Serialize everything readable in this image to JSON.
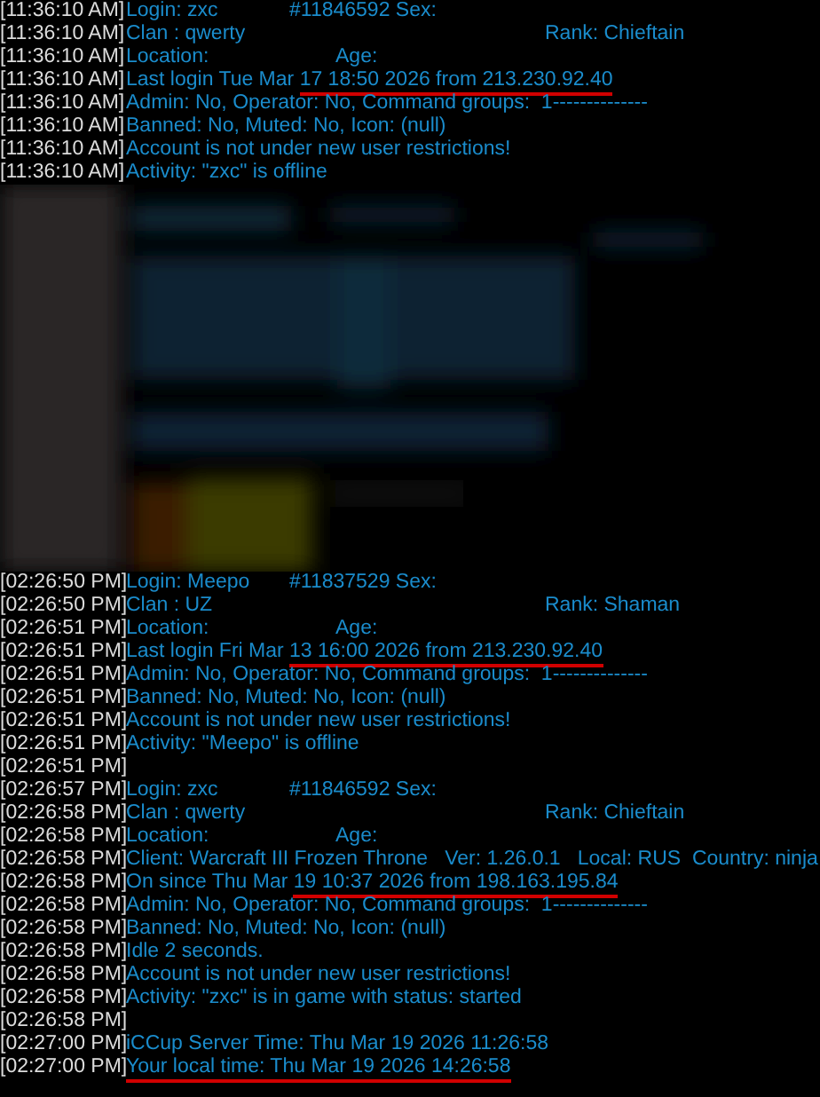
{
  "log_top": [
    {
      "time": "[11:36:10 AM]",
      "kind": "login",
      "text": "Login: zxc",
      "text_2": "#11846592 Sex:"
    },
    {
      "time": "[11:36:10 AM]",
      "kind": "clan",
      "text": "Clan : qwerty",
      "text_2": "Rank: Chieftain"
    },
    {
      "time": "[11:36:10 AM]",
      "kind": "location",
      "text": "Location:",
      "text_2": "Age:"
    },
    {
      "time": "[11:36:10 AM]",
      "kind": "plain",
      "text": "Last login Tue Mar ",
      "marked": "17 18:50 2026 from 213.230.92.40"
    },
    {
      "time": "[11:36:10 AM]",
      "kind": "plain",
      "text": "Admin: No, Operator: No, Command groups:  1--------------"
    },
    {
      "time": "[11:36:10 AM]",
      "kind": "plain",
      "text": "Banned: No, Muted: No, Icon: (null)"
    },
    {
      "time": "[11:36:10 AM]",
      "kind": "plain",
      "text": "Account is not under new user restrictions!"
    },
    {
      "time": "[11:36:10 AM]",
      "kind": "plain",
      "text": "Activity: \"zxc\" is offline"
    }
  ],
  "log_bottom": [
    {
      "time": "[02:26:50 PM]",
      "kind": "login",
      "text": "Login: Meepo",
      "text_2": "#11837529 Sex:"
    },
    {
      "time": "[02:26:50 PM]",
      "kind": "clan",
      "text": "Clan : UZ",
      "text_2": "Rank: Shaman"
    },
    {
      "time": "[02:26:51 PM]",
      "kind": "location",
      "text": "Location:",
      "text_2": "Age:"
    },
    {
      "time": "[02:26:51 PM]",
      "kind": "plain",
      "text": "Last login Fri Mar ",
      "marked": "13 16:00 2026 from 213.230.92.40"
    },
    {
      "time": "[02:26:51 PM]",
      "kind": "plain",
      "text": "Admin: No, Operator: No, Command groups:  1--------------"
    },
    {
      "time": "[02:26:51 PM]",
      "kind": "plain",
      "text": "Banned: No, Muted: No, Icon: (null)"
    },
    {
      "time": "[02:26:51 PM]",
      "kind": "plain",
      "text": "Account is not under new user restrictions!"
    },
    {
      "time": "[02:26:51 PM]",
      "kind": "plain",
      "text": "Activity: \"Meepo\" is offline"
    },
    {
      "time": "[02:26:51 PM]",
      "kind": "empty"
    },
    {
      "time": "[02:26:57 PM]",
      "kind": "login",
      "text": "Login: zxc",
      "text_2": "#11846592 Sex:"
    },
    {
      "time": "[02:26:58 PM]",
      "kind": "clan",
      "text": "Clan : qwerty",
      "text_2": "Rank: Chieftain"
    },
    {
      "time": "[02:26:58 PM]",
      "kind": "location",
      "text": "Location:",
      "text_2": "Age:"
    },
    {
      "time": "[02:26:58 PM]",
      "kind": "plain",
      "text": "Client: Warcraft III Frozen Throne   Ver: 1.26.0.1   Local: RUS  Country: ninja"
    },
    {
      "time": "[02:26:58 PM]",
      "kind": "plain",
      "text": "On since Thu Mar ",
      "marked": "19 10:37 2026 from 198.163.195.84"
    },
    {
      "time": "[02:26:58 PM]",
      "kind": "plain",
      "text": "Admin: No, Operator: No, Command groups:  1--------------"
    },
    {
      "time": "[02:26:58 PM]",
      "kind": "plain",
      "text": "Banned: No, Muted: No, Icon: (null)"
    },
    {
      "time": "[02:26:58 PM]",
      "kind": "plain",
      "text": "Idle 2 seconds."
    },
    {
      "time": "[02:26:58 PM]",
      "kind": "plain",
      "text": "Account is not under new user restrictions!"
    },
    {
      "time": "[02:26:58 PM]",
      "kind": "plain",
      "text": "Activity: \"zxc\" is in game with status: started"
    },
    {
      "time": "[02:26:58 PM]",
      "kind": "empty"
    },
    {
      "time": "[02:27:00 PM]",
      "kind": "plain",
      "text": "iCCup Server Time: Thu Mar 19 2026 11:26:58"
    },
    {
      "time": "[02:27:00 PM]",
      "kind": "plain",
      "marked": "Your local time: Thu Mar 19 2026 14:26:58"
    }
  ]
}
